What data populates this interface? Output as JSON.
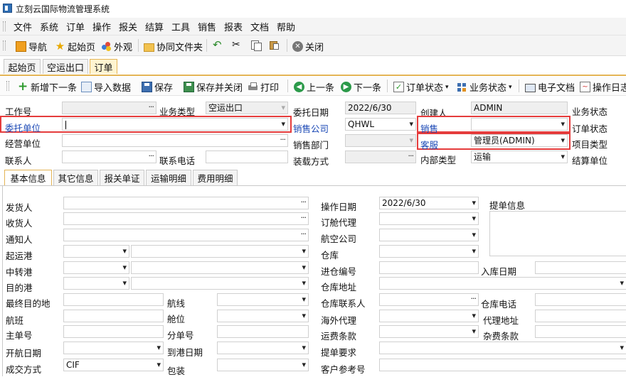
{
  "window": {
    "title": "立刻云国际物流管理系统"
  },
  "menu": [
    "文件",
    "系统",
    "订单",
    "操作",
    "报关",
    "结算",
    "工具",
    "销售",
    "报表",
    "文档",
    "帮助"
  ],
  "toolbar1": [
    {
      "label": "导航",
      "icon": "navigation-icon"
    },
    {
      "label": "起始页",
      "icon": "star-icon"
    },
    {
      "label": "外观",
      "icon": "palette-icon"
    },
    {
      "label": "协同文件夹",
      "icon": "folder-icon"
    },
    {
      "label": "",
      "icon": "undo-icon"
    },
    {
      "label": "",
      "icon": "cut-icon"
    },
    {
      "label": "",
      "icon": "copy-icon"
    },
    {
      "label": "",
      "icon": "paste-icon"
    },
    {
      "label": "关闭",
      "icon": "close-icon"
    }
  ],
  "doc_tabs": [
    "起始页",
    "空运出口",
    "订单"
  ],
  "toolbar2": [
    {
      "label": "新增下一条",
      "icon": "add-icon"
    },
    {
      "label": "导入数据",
      "icon": "import-icon"
    },
    {
      "label": "保存",
      "icon": "save-icon"
    },
    {
      "label": "保存并关闭",
      "icon": "save-close-icon"
    },
    {
      "label": "打印",
      "icon": "print-icon"
    },
    {
      "label": "上一条",
      "icon": "prev-icon"
    },
    {
      "label": "下一条",
      "icon": "next-icon"
    },
    {
      "label": "订单状态",
      "icon": "order-status-icon"
    },
    {
      "label": "业务状态",
      "icon": "business-status-icon"
    },
    {
      "label": "电子文档",
      "icon": "edoc-icon"
    },
    {
      "label": "操作日志",
      "icon": "log-icon"
    }
  ],
  "header_form": {
    "job_no": {
      "label": "工作号",
      "value": ""
    },
    "biz_type": {
      "label": "业务类型",
      "value": "空运出口"
    },
    "entrust_date": {
      "label": "委托日期",
      "value": "2022/6/30"
    },
    "creator": {
      "label": "创建人",
      "value": "ADMIN"
    },
    "biz_status": {
      "label": "业务状态"
    },
    "client": {
      "label": "委托单位",
      "value": ""
    },
    "sales_company": {
      "label": "销售公司",
      "value": "QHWL"
    },
    "sales": {
      "label": "销售",
      "value": ""
    },
    "order_status": {
      "label": "订单状态"
    },
    "operating_unit": {
      "label": "经营单位",
      "value": ""
    },
    "sales_dept": {
      "label": "销售部门",
      "value": ""
    },
    "customer_service": {
      "label": "客服",
      "value": "管理员(ADMIN)"
    },
    "project_type": {
      "label": "项目类型"
    },
    "contact": {
      "label": "联系人",
      "value": ""
    },
    "contact_phone": {
      "label": "联系电话",
      "value": ""
    },
    "loading_method": {
      "label": "装载方式",
      "value": ""
    },
    "internal_type": {
      "label": "内部类型",
      "value": "运输"
    },
    "settle_unit": {
      "label": "结算单位"
    }
  },
  "sub_tabs": [
    "基本信息",
    "其它信息",
    "报关单证",
    "运输明细",
    "费用明细"
  ],
  "basic": {
    "shipper": "发货人",
    "consignee": "收货人",
    "notify": "通知人",
    "pol": "起运港",
    "transit": "中转港",
    "pod": "目的港",
    "final_dest": "最终目的地",
    "route": "航线",
    "flight": "航班",
    "cabin": "舱位",
    "mawb": "主单号",
    "hawb": "分单号",
    "etd": "开航日期",
    "eta": "到港日期",
    "trade_term": {
      "label": "成交方式",
      "value": "CIF"
    },
    "packing": "包装",
    "op_date": {
      "label": "操作日期",
      "value": "2022/6/30"
    },
    "booking_agent": "订舱代理",
    "airline": "航空公司",
    "warehouse": "仓库",
    "inbound_no": "进仓编号",
    "inbound_date": "入库日期",
    "warehouse_addr": "仓库地址",
    "warehouse_contact": "仓库联系人",
    "warehouse_phone": "仓库电话",
    "overseas_agent": "海外代理",
    "agent_addr": "代理地址",
    "freight_term": "运费条款",
    "misc_term": "杂费条款",
    "bl_request": "提单要求",
    "customer_ref": "客户参考号",
    "bl_info": "提单信息"
  }
}
